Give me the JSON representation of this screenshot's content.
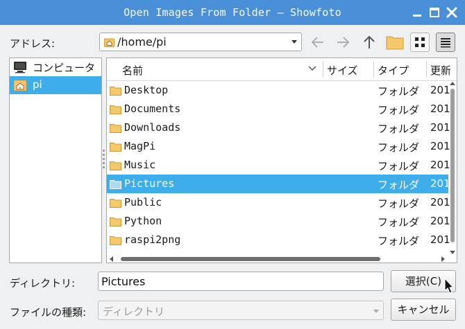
{
  "window": {
    "title": "Open Images From Folder — Showfoto"
  },
  "address": {
    "label": "アドレス:",
    "path": "/home/pi"
  },
  "places": [
    {
      "label": "コンピュータ",
      "icon": "computer-icon"
    },
    {
      "label": "pi",
      "icon": "home-folder-icon",
      "selected": true
    }
  ],
  "columns": {
    "name": "名前",
    "size": "サイズ",
    "type": "タイプ",
    "date": "更新"
  },
  "files": [
    {
      "name": "Desktop",
      "type": "フォルダ",
      "date": "201"
    },
    {
      "name": "Documents",
      "type": "フォルダ",
      "date": "201"
    },
    {
      "name": "Downloads",
      "type": "フォルダ",
      "date": "201"
    },
    {
      "name": "MagPi",
      "type": "フォルダ",
      "date": "201"
    },
    {
      "name": "Music",
      "type": "フォルダ",
      "date": "201"
    },
    {
      "name": "Pictures",
      "type": "フォルダ",
      "date": "201",
      "selected": true
    },
    {
      "name": "Public",
      "type": "フォルダ",
      "date": "201"
    },
    {
      "name": "Python",
      "type": "フォルダ",
      "date": "201"
    },
    {
      "name": "raspi2png",
      "type": "フォルダ",
      "date": "201"
    }
  ],
  "directory": {
    "label": "ディレクトリ:",
    "value": "Pictures"
  },
  "filetype": {
    "label": "ファイルの種類:",
    "value": "ディレクトリ"
  },
  "buttons": {
    "select": "選択(C)",
    "cancel": "キャンセル"
  },
  "colors": {
    "titlebar": "#4a90d9",
    "selection": "#3daee9",
    "folder": "#f5c96b"
  }
}
